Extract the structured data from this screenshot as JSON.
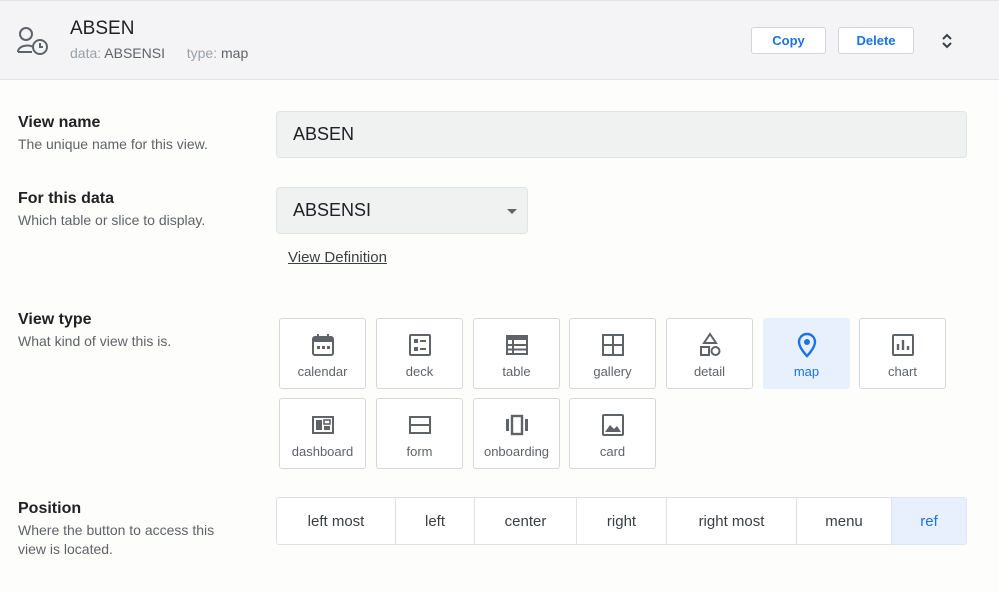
{
  "header": {
    "title": "ABSEN",
    "data_label": "data:",
    "data_value": "ABSENSI",
    "type_label": "type:",
    "type_value": "map",
    "copy_label": "Copy",
    "delete_label": "Delete",
    "view_icon": "view-clock-user-icon",
    "expand_icon": "unfold-icon"
  },
  "fields": {
    "view_name": {
      "label": "View name",
      "desc": "The unique name for this view.",
      "value": "ABSEN"
    },
    "for_this_data": {
      "label": "For this data",
      "desc": "Which table or slice to display.",
      "value": "ABSENSI",
      "link": "View Definition"
    },
    "view_type": {
      "label": "View type",
      "desc": "What kind of view this is.",
      "selected": "map",
      "options": [
        {
          "label": "calendar",
          "icon": "calendar-icon"
        },
        {
          "label": "deck",
          "icon": "deck-icon"
        },
        {
          "label": "table",
          "icon": "table-icon"
        },
        {
          "label": "gallery",
          "icon": "gallery-icon"
        },
        {
          "label": "detail",
          "icon": "detail-icon"
        },
        {
          "label": "map",
          "icon": "map-pin-icon"
        },
        {
          "label": "chart",
          "icon": "chart-icon"
        },
        {
          "label": "dashboard",
          "icon": "dashboard-icon"
        },
        {
          "label": "form",
          "icon": "form-icon"
        },
        {
          "label": "onboarding",
          "icon": "onboarding-icon"
        },
        {
          "label": "card",
          "icon": "card-icon"
        }
      ]
    },
    "position": {
      "label": "Position",
      "desc_line1": "Where the button to access this",
      "desc_line2": "view is located.",
      "selected": "ref",
      "options": [
        "left most",
        "left",
        "center",
        "right",
        "right most",
        "menu",
        "ref"
      ]
    }
  },
  "colors": {
    "accent": "#1a73e8",
    "selected_bg": "#e8f0fe",
    "header_bg": "#f4f4f6",
    "icon_gray": "#5f6368"
  }
}
